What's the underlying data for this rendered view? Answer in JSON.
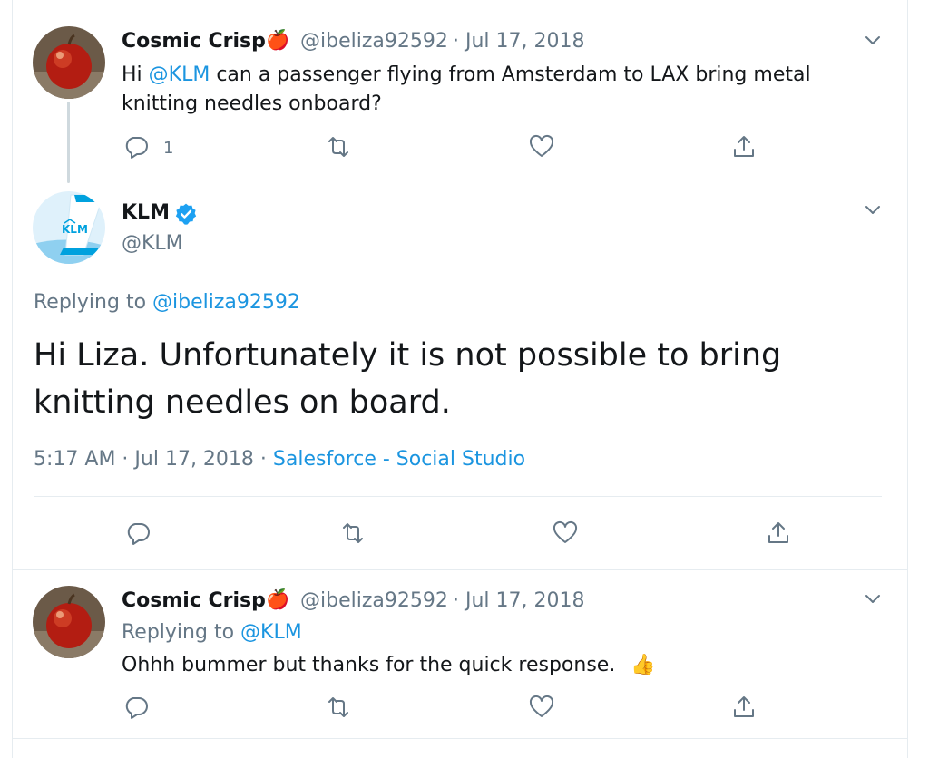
{
  "tweets": [
    {
      "name": "Cosmic Crisp",
      "emoji": "🍎",
      "handle": "@ibeliza92592",
      "date": "· Jul 17, 2018",
      "text_pre": "Hi ",
      "mention": "@KLM",
      "text_post": " can a passenger flying from Amsterdam to LAX bring metal",
      "text_line2": "knitting needles onboard?",
      "reply_count": "1"
    },
    {
      "name": "KLM",
      "handle": "@KLM",
      "replying_label": "Replying to ",
      "replying_to": "@ibeliza92592",
      "text": "Hi Liza. Unfortunately it is not possible to bring knitting needles on board.",
      "time": "5:17 AM · Jul 17, 2018 · ",
      "source": "Salesforce - Social Studio"
    },
    {
      "name": "Cosmic Crisp",
      "emoji": "🍎",
      "handle": "@ibeliza92592",
      "date": "· Jul 17, 2018",
      "replying_label": "Replying to ",
      "replying_to": "@KLM",
      "text": "Ohhh bummer but thanks for the quick response.",
      "emoji_end": "👍"
    }
  ],
  "icons": {
    "more": "chevron-down-icon",
    "reply": "reply-icon",
    "retweet": "retweet-icon",
    "like": "heart-icon",
    "share": "share-icon",
    "verified": "verified-badge-icon"
  },
  "colors": {
    "link": "#1b95e0",
    "muted": "#657786",
    "verified": "#1da1f2",
    "divider": "#e6ecf0"
  }
}
